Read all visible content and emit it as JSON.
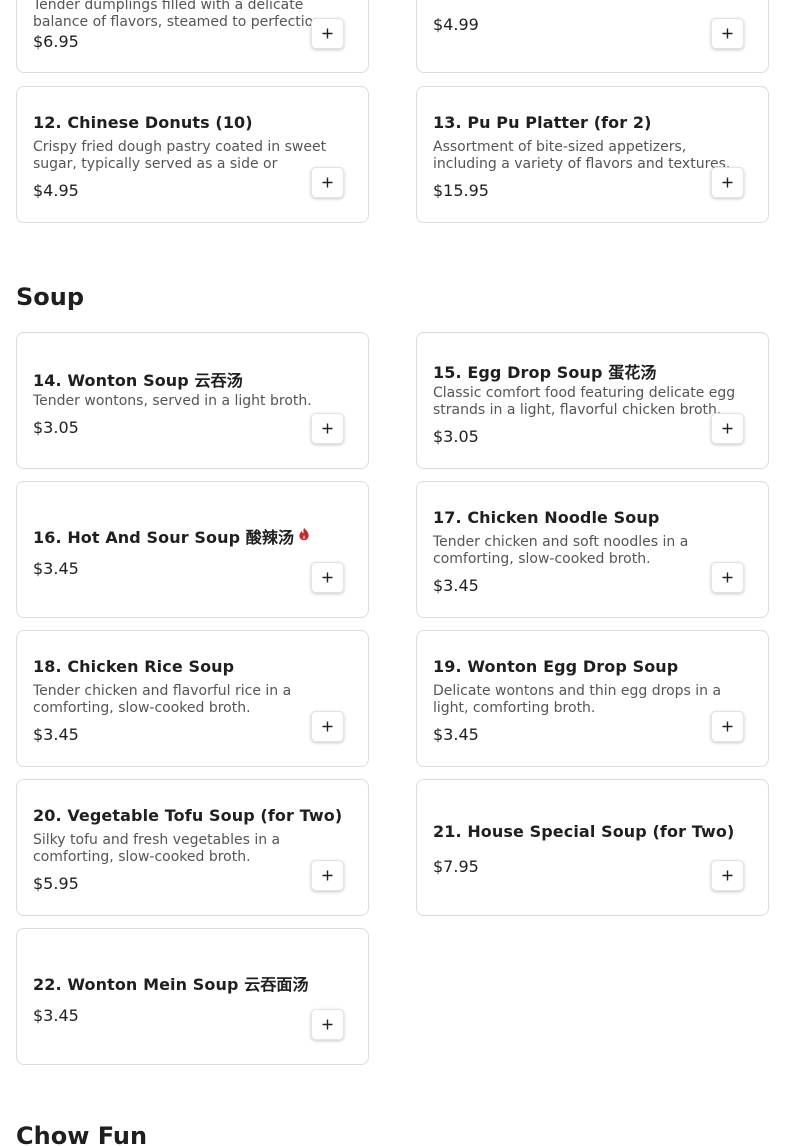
{
  "sections": {
    "appetizers_partial": {
      "items": [
        {
          "desc": "Tender dumplings filled with a delicate balance of flavors, steamed to perfection.",
          "price": "$6.95"
        },
        {
          "price": "$4.99"
        },
        {
          "name": "12. Chinese Donuts (10)",
          "desc": "Crispy fried dough pastry coated in sweet sugar, typically served as a side or dessert.",
          "price": "$4.95"
        },
        {
          "name": "13. Pu Pu Platter (for 2)",
          "desc": "Assortment of bite-sized appetizers, including a variety of flavors and textures.",
          "price": "$15.95"
        }
      ]
    },
    "soup": {
      "title": "Soup",
      "items": [
        {
          "name": "14. Wonton Soup 云吞汤",
          "desc": "Tender wontons, served in a light broth.",
          "price": "$3.05"
        },
        {
          "name": "15. Egg Drop Soup 蛋花汤",
          "desc": "Classic comfort food featuring delicate egg strands in a light, flavorful chicken broth.",
          "price": "$3.05"
        },
        {
          "name": "16. Hot And Sour Soup 酸辣汤",
          "price": "$3.45",
          "spicy": true
        },
        {
          "name": "17. Chicken Noodle Soup",
          "desc": "Tender chicken and soft noodles in a comforting, slow-cooked broth.",
          "price": "$3.45"
        },
        {
          "name": "18. Chicken Rice Soup",
          "desc": "Tender chicken and flavorful rice in a comforting, slow-cooked broth.",
          "price": "$3.45"
        },
        {
          "name": "19. Wonton Egg Drop Soup",
          "desc": "Delicate wontons and thin egg drops in a light, comforting broth.",
          "price": "$3.45"
        },
        {
          "name": "20. Vegetable Tofu Soup (for Two)",
          "desc": "Silky tofu and fresh vegetables in a comforting, slow-cooked broth.",
          "price": "$5.95"
        },
        {
          "name": "21. House Special Soup (for Two)",
          "price": "$7.95"
        },
        {
          "name": "22. Wonton Mein Soup 云吞面汤",
          "price": "$3.45"
        }
      ]
    },
    "chow_fun": {
      "title": "Chow Fun"
    }
  },
  "icons": {
    "add": "plus-icon",
    "spicy": "chili-pepper-icon"
  },
  "colors": {
    "spicy": "#c62828",
    "border": "#dcdcdc",
    "text": "#1f1f1f",
    "muted": "#555555"
  }
}
